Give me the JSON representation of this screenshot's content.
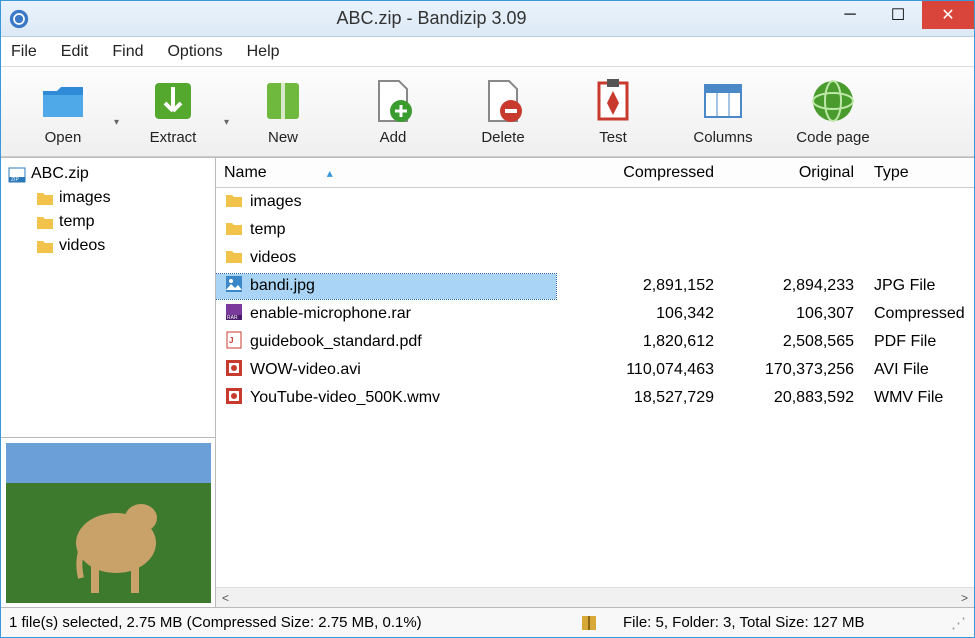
{
  "title": "ABC.zip - Bandizip 3.09",
  "menu": {
    "file": "File",
    "edit": "Edit",
    "find": "Find",
    "options": "Options",
    "help": "Help"
  },
  "toolbar": {
    "open": "Open",
    "extract": "Extract",
    "new": "New",
    "add": "Add",
    "delete": "Delete",
    "test": "Test",
    "columns": "Columns",
    "codepage": "Code page"
  },
  "tree": {
    "root": "ABC.zip",
    "children": [
      "images",
      "temp",
      "videos"
    ]
  },
  "columns": {
    "name": "Name",
    "compressed": "Compressed",
    "original": "Original",
    "type": "Type"
  },
  "rows": [
    {
      "name": "images",
      "kind": "folder",
      "compressed": "",
      "original": "",
      "type": ""
    },
    {
      "name": "temp",
      "kind": "folder",
      "compressed": "",
      "original": "",
      "type": ""
    },
    {
      "name": "videos",
      "kind": "folder",
      "compressed": "",
      "original": "",
      "type": ""
    },
    {
      "name": "bandi.jpg",
      "kind": "jpg",
      "compressed": "2,891,152",
      "original": "2,894,233",
      "type": "JPG File",
      "selected": true
    },
    {
      "name": "enable-microphone.rar",
      "kind": "rar",
      "compressed": "106,342",
      "original": "106,307",
      "type": "Compressed"
    },
    {
      "name": "guidebook_standard.pdf",
      "kind": "pdf",
      "compressed": "1,820,612",
      "original": "2,508,565",
      "type": "PDF File"
    },
    {
      "name": "WOW-video.avi",
      "kind": "video",
      "compressed": "110,074,463",
      "original": "170,373,256",
      "type": "AVI File"
    },
    {
      "name": "YouTube-video_500K.wmv",
      "kind": "video",
      "compressed": "18,527,729",
      "original": "20,883,592",
      "type": "WMV File"
    }
  ],
  "status": {
    "left": "1 file(s) selected, 2.75 MB (Compressed Size: 2.75 MB, 0.1%)",
    "right": "File: 5, Folder: 3, Total Size: 127 MB"
  }
}
